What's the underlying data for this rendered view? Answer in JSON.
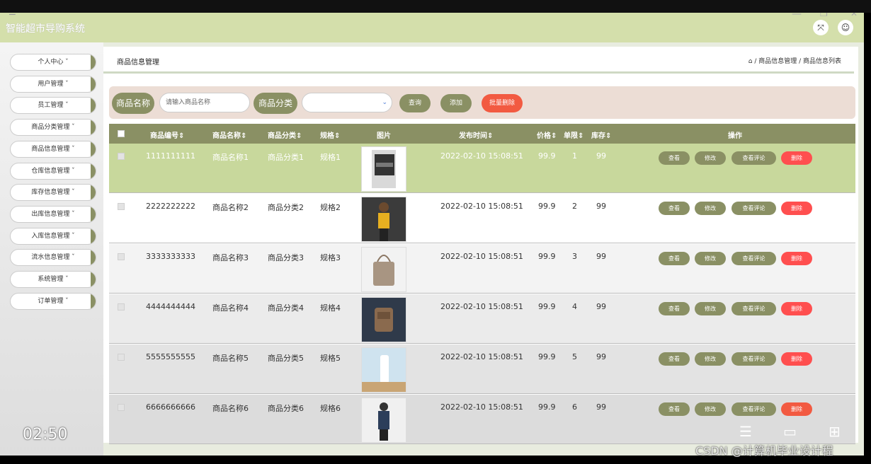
{
  "app": {
    "title": "智能超市导购系统",
    "time_overlay": "02:50",
    "watermark": "CSDN @计算机毕业设计程"
  },
  "sidebar": {
    "items": [
      {
        "label": "个人中心 ˇ"
      },
      {
        "label": "用户管理 ˇ"
      },
      {
        "label": "员工管理 ˇ"
      },
      {
        "label": "商品分类管理 ˇ"
      },
      {
        "label": "商品信息管理 ˇ"
      },
      {
        "label": "仓库信息管理 ˇ"
      },
      {
        "label": "库存信息管理 ˇ"
      },
      {
        "label": "出库信息管理 ˇ"
      },
      {
        "label": "入库信息管理 ˇ"
      },
      {
        "label": "流水信息管理 ˇ"
      },
      {
        "label": "系统管理 ˇ"
      },
      {
        "label": "订单管理 ˇ"
      }
    ]
  },
  "page": {
    "title": "商品信息管理",
    "breadcrumb": "⌂ / 商品信息管理 / 商品信息列表"
  },
  "search": {
    "name_label": "商品名称",
    "name_placeholder": "请输入商品名称",
    "category_label": "商品分类",
    "category_value": "",
    "query_button": "查询",
    "add_button": "添加",
    "batch_delete_button": "批量删除"
  },
  "table": {
    "headers": [
      "商品编号",
      "商品名称",
      "商品分类",
      "规格",
      "图片",
      "发布时间",
      "价格",
      "单限",
      "库存",
      "操作"
    ],
    "sort_icon": "⇕",
    "rows": [
      {
        "id": "1111111111",
        "name": "商品名称1",
        "category": "商品分类1",
        "spec": "规格1",
        "time": "2022-02-10 15:08:51",
        "price": "99.9",
        "limit": "1",
        "stock": "99"
      },
      {
        "id": "2222222222",
        "name": "商品名称2",
        "category": "商品分类2",
        "spec": "规格2",
        "time": "2022-02-10 15:08:51",
        "price": "99.9",
        "limit": "2",
        "stock": "99"
      },
      {
        "id": "3333333333",
        "name": "商品名称3",
        "category": "商品分类3",
        "spec": "规格3",
        "time": "2022-02-10 15:08:51",
        "price": "99.9",
        "limit": "3",
        "stock": "99"
      },
      {
        "id": "4444444444",
        "name": "商品名称4",
        "category": "商品分类4",
        "spec": "规格4",
        "time": "2022-02-10 15:08:51",
        "price": "99.9",
        "limit": "4",
        "stock": "99"
      },
      {
        "id": "5555555555",
        "name": "商品名称5",
        "category": "商品分类5",
        "spec": "规格5",
        "time": "2022-02-10 15:08:51",
        "price": "99.9",
        "limit": "5",
        "stock": "99"
      },
      {
        "id": "6666666666",
        "name": "商品名称6",
        "category": "商品分类6",
        "spec": "规格6",
        "time": "2022-02-10 15:08:51",
        "price": "99.9",
        "limit": "6",
        "stock": "99"
      }
    ],
    "actions": {
      "view": "查看",
      "edit": "修改",
      "reviews": "查看评论",
      "delete": "删除"
    }
  },
  "colors": {
    "accent": "#8a9064",
    "header": "#d4dfab",
    "highlight_row": "#c8d89c",
    "danger": "#f25a41"
  }
}
